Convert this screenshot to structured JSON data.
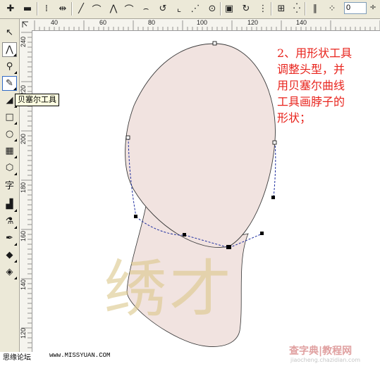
{
  "property_bar": {
    "nudge_value": "0",
    "spin_glyph": "÷"
  },
  "toolbox": {
    "active_tool": "bezier-tool",
    "tooltip": "贝塞尔工具"
  },
  "rulers": {
    "top_labels": [
      "40",
      "60",
      "80",
      "100",
      "120",
      "140"
    ],
    "left_labels": [
      "240",
      "220",
      "200",
      "180",
      "160",
      "140",
      "120"
    ]
  },
  "annotation": {
    "lines": [
      "2、用形状工具",
      "调整头型，并",
      "用贝塞尔曲线",
      "工具画脖子的",
      "形状；"
    ]
  },
  "watermark": "绣才",
  "footer": {
    "left_text": "思缘论坛",
    "url": "www.MISSYUAN.COM",
    "logo_text": "查字典|教程网",
    "logo_sub": "jiaocheng.chazidian.com"
  },
  "colors": {
    "shape_fill": "#f1e3e0",
    "annotation": "#e8231c",
    "control_line": "#1f2fa0"
  }
}
